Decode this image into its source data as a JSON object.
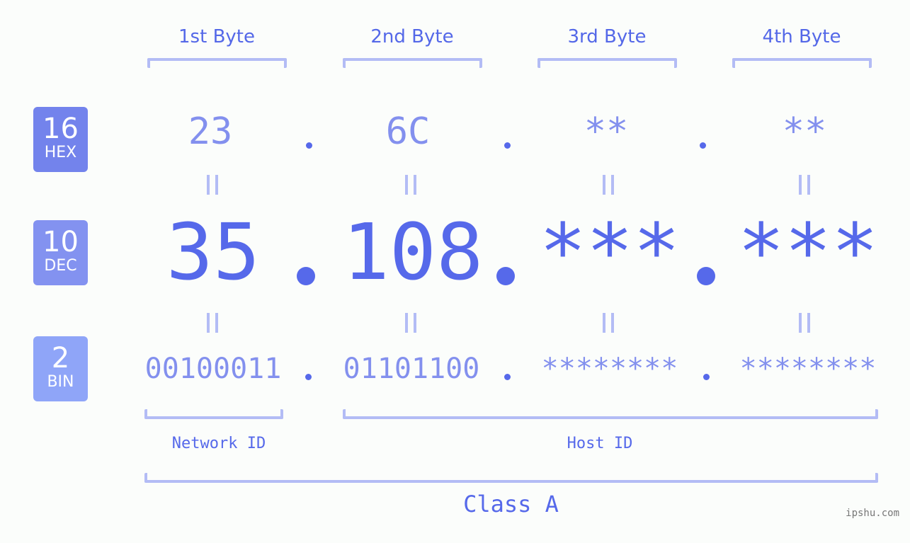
{
  "headers": [
    "1st Byte",
    "2nd Byte",
    "3rd Byte",
    "4th Byte"
  ],
  "bases": [
    {
      "number": "16",
      "label": "HEX",
      "color": "#7383ec"
    },
    {
      "number": "10",
      "label": "DEC",
      "color": "#8392f0"
    },
    {
      "number": "2",
      "label": "BIN",
      "color": "#8fa5f8"
    }
  ],
  "hex": [
    "23",
    "6C",
    "**",
    "**"
  ],
  "dec": [
    "35",
    "108",
    "***",
    "***"
  ],
  "bin": [
    "00100011",
    "01101100",
    "********",
    "********"
  ],
  "separator": ".",
  "network_id_label": "Network ID",
  "host_id_label": "Host ID",
  "class_label": "Class A",
  "watermark": "ipshu.com",
  "colors": {
    "accent": "#5669ea",
    "light_value": "#8390ee",
    "bracket": "#b3bcf5",
    "background": "#fbfdfb"
  }
}
